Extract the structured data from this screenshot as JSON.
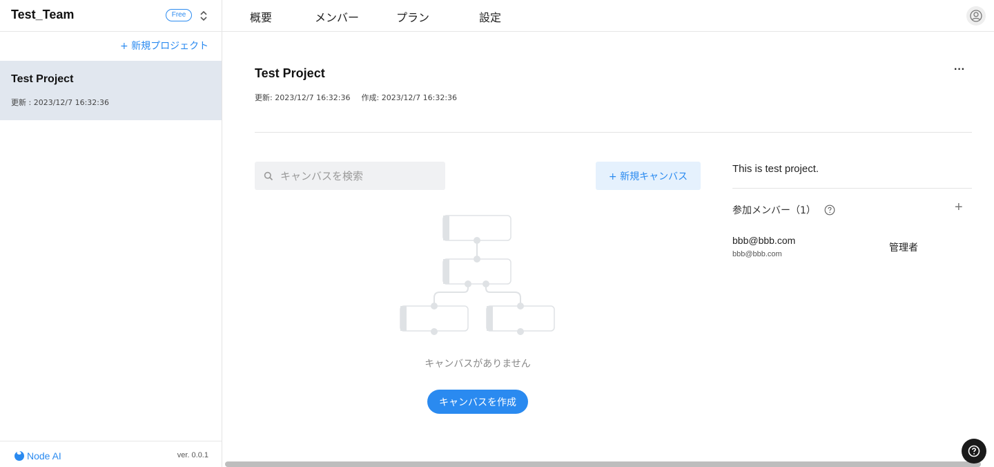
{
  "team": {
    "name": "Test_Team",
    "plan_badge": "Free"
  },
  "sidebar": {
    "new_project_label": "+ 新規プロジェクト",
    "projects": [
      {
        "name": "Test Project",
        "updated": "更新 : 2023/12/7 16:32:36"
      }
    ],
    "brand": "Node AI",
    "version": "ver. 0.0.1"
  },
  "nav": {
    "tabs": [
      {
        "label": "概要"
      },
      {
        "label": "メンバー"
      },
      {
        "label": "プラン"
      },
      {
        "label": "設定"
      }
    ]
  },
  "project": {
    "title": "Test Project",
    "updated": "更新: 2023/12/7 16:32:36",
    "created": "作成: 2023/12/7 16:32:36",
    "more_label": "···"
  },
  "canvas": {
    "search_placeholder": "キャンバスを検索",
    "new_canvas_label": "+ 新規キャンバス",
    "empty_text": "キャンバスがありません",
    "create_label": "キャンバスを作成"
  },
  "details": {
    "description": "This is test project.",
    "members_heading": "参加メンバー（1）",
    "add_label": "+",
    "members": [
      {
        "name": "bbb@bbb.com",
        "email": "bbb@bbb.com",
        "role": "管理者"
      }
    ]
  },
  "colors": {
    "accent": "#2a8af0",
    "selected_bg": "#e1e7ef",
    "button_light": "#e5f1fd"
  },
  "icons": [
    "switch-chevrons-icon",
    "user-icon",
    "search-icon",
    "node-ai-logo-icon",
    "question-circle-icon",
    "help-icon"
  ]
}
